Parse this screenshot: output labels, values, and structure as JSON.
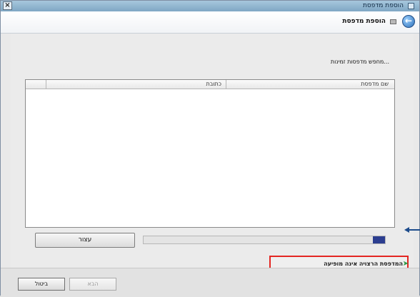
{
  "window": {
    "title": "הוספת מדפסת",
    "close_label": "×"
  },
  "header": {
    "title": "הוספת מדפסת",
    "back_icon": "back-arrow-icon",
    "printer_icon": "printer-icon"
  },
  "search": {
    "status_text": "מחפש מדפסות זמינות..."
  },
  "list": {
    "columns": [
      {
        "label": "שם מדפסת"
      },
      {
        "label": "כתובת"
      }
    ],
    "rows": []
  },
  "progress": {
    "fraction": 0.05
  },
  "stop_button": {
    "label": "עצור"
  },
  "not_listed": {
    "label": "המדפסת הרצויה אינה מופיעה",
    "highlight_color": "#e32622",
    "icon": "green-arrow-icon"
  },
  "footer": {
    "cancel_label": "ביטול",
    "next_label": "הבא"
  },
  "colors": {
    "accent": "#2c3e90",
    "callout_arrow": "#1d4c8c"
  }
}
